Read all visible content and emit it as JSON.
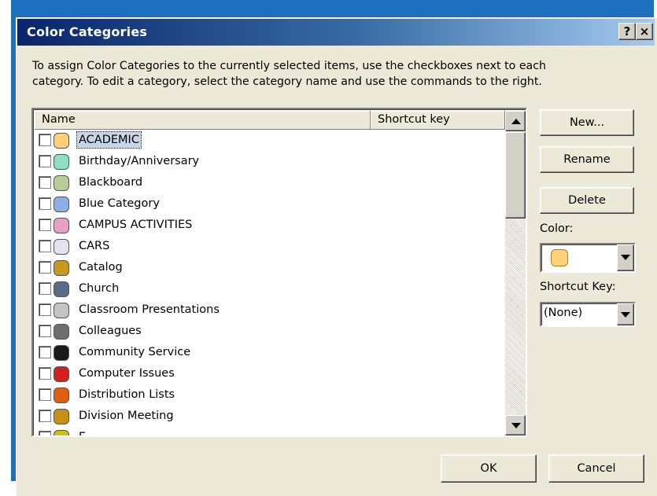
{
  "dialog": {
    "title": "Color Categories",
    "help_label": "?",
    "close_label": "×",
    "description_line1": "To assign Color Categories to the currently selected items, use the checkboxes next to each",
    "description_line2": "category.  To edit a category, select the category name and use the commands to the right."
  },
  "list": {
    "col_name": "Name",
    "col_shortcut": "Shortcut key",
    "items": [
      {
        "label": "ACADEMIC",
        "color": "#ffd27a",
        "selected": true
      },
      {
        "label": "Birthday/Anniversary",
        "color": "#8ee0c0"
      },
      {
        "label": "Blackboard",
        "color": "#b8cc98"
      },
      {
        "label": "Blue Category",
        "color": "#8eaee8"
      },
      {
        "label": "CAMPUS ACTIVITIES",
        "color": "#e8a0c4"
      },
      {
        "label": "CARS",
        "color": "#e4e4f0"
      },
      {
        "label": "Catalog",
        "color": "#c89820"
      },
      {
        "label": "Church",
        "color": "#5a6a88"
      },
      {
        "label": "Classroom Presentations",
        "color": "#c4c4c4"
      },
      {
        "label": "Colleagues",
        "color": "#6e6e6e"
      },
      {
        "label": "Community Service",
        "color": "#1a1a1a"
      },
      {
        "label": "Computer Issues",
        "color": "#d02020"
      },
      {
        "label": "Distribution Lists",
        "color": "#e06010"
      },
      {
        "label": "Division Meeting",
        "color": "#c89010"
      },
      {
        "label": "E...",
        "color": "#d4c010"
      }
    ]
  },
  "buttons": {
    "new": "New...",
    "rename": "Rename",
    "delete": "Delete",
    "ok": "OK",
    "cancel": "Cancel"
  },
  "color_field": {
    "label": "Color:",
    "selected_color": "#ffd27a"
  },
  "shortcut_field": {
    "label": "Shortcut Key:",
    "value": "(None)"
  }
}
